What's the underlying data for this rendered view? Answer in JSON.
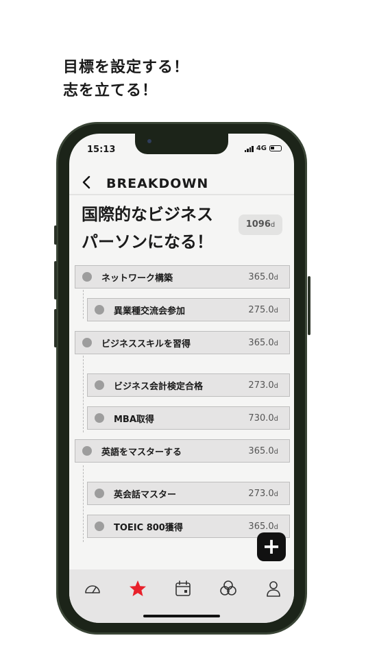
{
  "promo": {
    "line1": "目標を設定する！",
    "line2": "志を立てる！"
  },
  "status": {
    "time": "15:13",
    "network": "4G"
  },
  "nav": {
    "title": "BREAKDOWN",
    "back_icon": "chevron-left-icon"
  },
  "goal": {
    "title_line1": "国際的なビジネス",
    "title_line2": "パーソンになる！",
    "days_value": "1096",
    "days_unit": "d"
  },
  "tasks": [
    {
      "label": "ネットワーク構築",
      "days": "365.0",
      "unit": "d",
      "level": 0
    },
    {
      "label": "異業種交流会参加",
      "days": "275.0",
      "unit": "d",
      "level": 1
    },
    {
      "label": "ビジネススキルを習得",
      "days": "365.0",
      "unit": "d",
      "level": 0
    },
    {
      "label": "ビジネス会計検定合格",
      "days": "273.0",
      "unit": "d",
      "level": 1
    },
    {
      "label": "MBA取得",
      "days": "730.0",
      "unit": "d",
      "level": 1
    },
    {
      "label": "英語をマスターする",
      "days": "365.0",
      "unit": "d",
      "level": 0
    },
    {
      "label": "英会話マスター",
      "days": "273.0",
      "unit": "d",
      "level": 1
    },
    {
      "label": "TOEIC 800獲得",
      "days": "365.0",
      "unit": "d",
      "level": 1
    }
  ],
  "fab": {
    "icon": "plus-icon",
    "glyph": "+"
  },
  "tabs": [
    {
      "icon": "gauge-icon"
    },
    {
      "icon": "star-icon",
      "active": true,
      "color": "#e8212b"
    },
    {
      "icon": "calendar-icon"
    },
    {
      "icon": "circles-icon"
    },
    {
      "icon": "person-icon"
    }
  ]
}
